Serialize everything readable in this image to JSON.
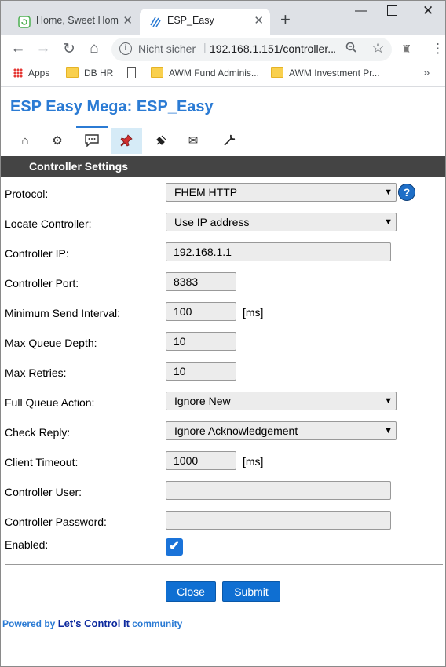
{
  "browser": {
    "tabs": [
      {
        "title": "Home, Sweet Home",
        "active": false
      },
      {
        "title": "ESP_Easy",
        "active": true
      }
    ],
    "address": {
      "security_label": "Nicht sicher",
      "url": "192.168.1.151/controller..."
    },
    "bookmarks": [
      {
        "label": "Apps",
        "icon": "apps-icon"
      },
      {
        "label": "DB HR",
        "icon": "folder-icon"
      },
      {
        "label": "",
        "icon": "page-icon"
      },
      {
        "label": "AWM Fund Adminis...",
        "icon": "folder-icon"
      },
      {
        "label": "AWM Investment Pr...",
        "icon": "folder-icon"
      }
    ]
  },
  "page": {
    "title": "ESP Easy Mega: ESP_Easy",
    "menu": [
      "main-icon",
      "config-icon",
      "controllers-icon",
      "hardware-icon",
      "devices-icon",
      "notifications-icon",
      "tools-icon"
    ],
    "active_menu": "controllers-icon",
    "section_title": "Controller Settings",
    "fields": {
      "protocol": {
        "label": "Protocol:",
        "value": "FHEM HTTP"
      },
      "locate": {
        "label": "Locate Controller:",
        "value": "Use IP address"
      },
      "ip": {
        "label": "Controller IP:",
        "value": "192.168.1.1"
      },
      "port": {
        "label": "Controller Port:",
        "value": "8383"
      },
      "min_interval": {
        "label": "Minimum Send Interval:",
        "value": "100",
        "unit": "[ms]"
      },
      "queue_depth": {
        "label": "Max Queue Depth:",
        "value": "10"
      },
      "retries": {
        "label": "Max Retries:",
        "value": "10"
      },
      "full_queue": {
        "label": "Full Queue Action:",
        "value": "Ignore New"
      },
      "check_reply": {
        "label": "Check Reply:",
        "value": "Ignore Acknowledgement"
      },
      "timeout": {
        "label": "Client Timeout:",
        "value": "1000",
        "unit": "[ms]"
      },
      "user": {
        "label": "Controller User:",
        "value": ""
      },
      "password": {
        "label": "Controller Password:",
        "value": ""
      },
      "enabled": {
        "label": "Enabled:",
        "checked": true
      }
    },
    "buttons": {
      "close": "Close",
      "submit": "Submit"
    },
    "footer": {
      "prefix": "Powered by",
      "brand": "Let's Control It",
      "suffix": "community"
    },
    "colors": {
      "accent": "#2b7bd4",
      "section_bar": "#444444",
      "button": "#0f6fd2"
    }
  }
}
